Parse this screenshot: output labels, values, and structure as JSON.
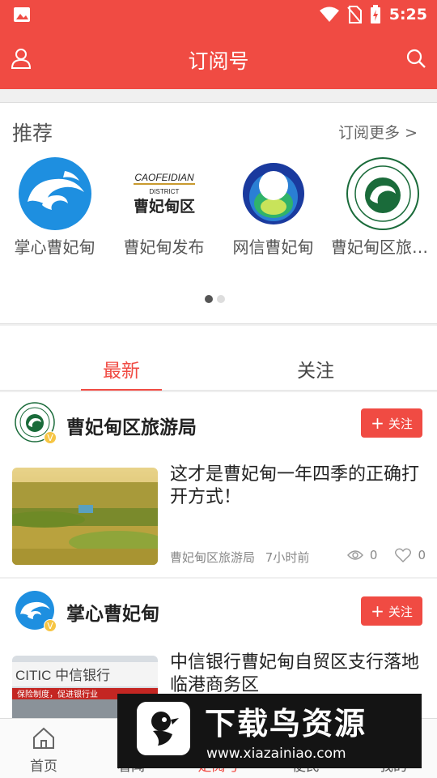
{
  "status_bar": {
    "time": "5:25"
  },
  "app_bar": {
    "title": "订阅号"
  },
  "recommend": {
    "heading": "推荐",
    "more": "订阅更多 >",
    "items": [
      {
        "name": "掌心曹妃甸",
        "icon": "wave-logo-icon"
      },
      {
        "name": "曹妃甸发布",
        "icon": "caofeidian-district-logo-icon",
        "logo_top": "CAOFEIDIAN",
        "logo_sub": "DISTRICT",
        "logo_cn": "曹妃甸区"
      },
      {
        "name": "网信曹妃甸",
        "icon": "globe-logo-icon"
      },
      {
        "name": "曹妃甸区旅游局",
        "icon": "tourism-seal-icon"
      }
    ],
    "page_dots": 2,
    "active_dot": 0
  },
  "tabs": [
    {
      "label": "最新",
      "active": true
    },
    {
      "label": "关注",
      "active": false
    }
  ],
  "feed": [
    {
      "account": "曹妃甸区旅游局",
      "follow_label": "关注",
      "title": "这才是曹妃甸一年四季的正确打开方式！",
      "source": "曹妃甸区旅游局",
      "time": "7小时前",
      "views": "0",
      "likes": "0"
    },
    {
      "account": "掌心曹妃甸",
      "follow_label": "关注",
      "title": "中信银行曹妃甸自贸区支行落地临港商务区",
      "thumb_text": "CITIC 中信银行",
      "thumb_sub": "保险制度，促进银行业"
    }
  ],
  "bottom_nav": [
    {
      "label": "首页",
      "icon": "home-icon"
    },
    {
      "label": "看闻",
      "icon": "news-icon"
    },
    {
      "label": "定阅号",
      "icon": "subscription-icon",
      "active": true
    },
    {
      "label": "便民",
      "icon": "service-icon"
    },
    {
      "label": "我的",
      "icon": "profile-icon"
    }
  ],
  "watermark": {
    "main": "下载鸟资源",
    "url": "www.xiazainiao.com"
  },
  "colors": {
    "brand": "#f04b43",
    "badge": "#f6c544"
  }
}
